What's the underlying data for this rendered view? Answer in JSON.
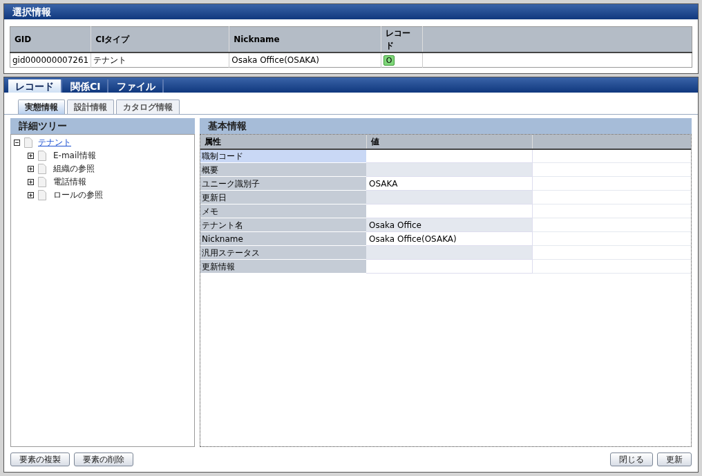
{
  "selection_panel": {
    "title": "選択情報",
    "columns": [
      "GID",
      "CIタイプ",
      "Nickname",
      "レコード"
    ],
    "rows": [
      {
        "gid": "gid000000007261",
        "ci_type": "テナント",
        "nickname": "Osaka Office(OSAKA)",
        "record": "O"
      }
    ]
  },
  "tabs": [
    {
      "label": "レコード",
      "selected": true
    },
    {
      "label": "関係CI",
      "selected": false
    },
    {
      "label": "ファイル",
      "selected": false
    }
  ],
  "subtabs": [
    {
      "label": "実態情報",
      "selected": true
    },
    {
      "label": "設計情報",
      "selected": false
    },
    {
      "label": "カタログ情報",
      "selected": false
    }
  ],
  "tree_panel": {
    "title": "詳細ツリー",
    "items": [
      {
        "label": "テナント",
        "expanded": true,
        "children": [
          {
            "label": "E-mail情報",
            "expanded": false
          },
          {
            "label": "組織の参照",
            "expanded": false
          },
          {
            "label": "電話情報",
            "expanded": false
          },
          {
            "label": "ロールの参照",
            "expanded": false
          }
        ]
      }
    ]
  },
  "detail_panel": {
    "title": "基本情報",
    "columns": [
      "属性",
      "値"
    ],
    "rows": [
      {
        "attribute": "職制コード",
        "value": "",
        "selected": true
      },
      {
        "attribute": "概要",
        "value": "",
        "selected": false
      },
      {
        "attribute": "ユニーク識別子",
        "value": "OSAKA",
        "selected": false
      },
      {
        "attribute": "更新日",
        "value": "",
        "selected": false
      },
      {
        "attribute": "メモ",
        "value": "",
        "selected": false
      },
      {
        "attribute": "テナント名",
        "value": "Osaka Office",
        "selected": false
      },
      {
        "attribute": "Nickname",
        "value": "Osaka Office(OSAKA)",
        "selected": false
      },
      {
        "attribute": "汎用ステータス",
        "value": "",
        "selected": false
      },
      {
        "attribute": "更新情報",
        "value": "",
        "selected": false
      }
    ]
  },
  "left_buttons": [
    "要素の複製",
    "要素の削除"
  ],
  "right_buttons": [
    "閉じる",
    "更新"
  ]
}
